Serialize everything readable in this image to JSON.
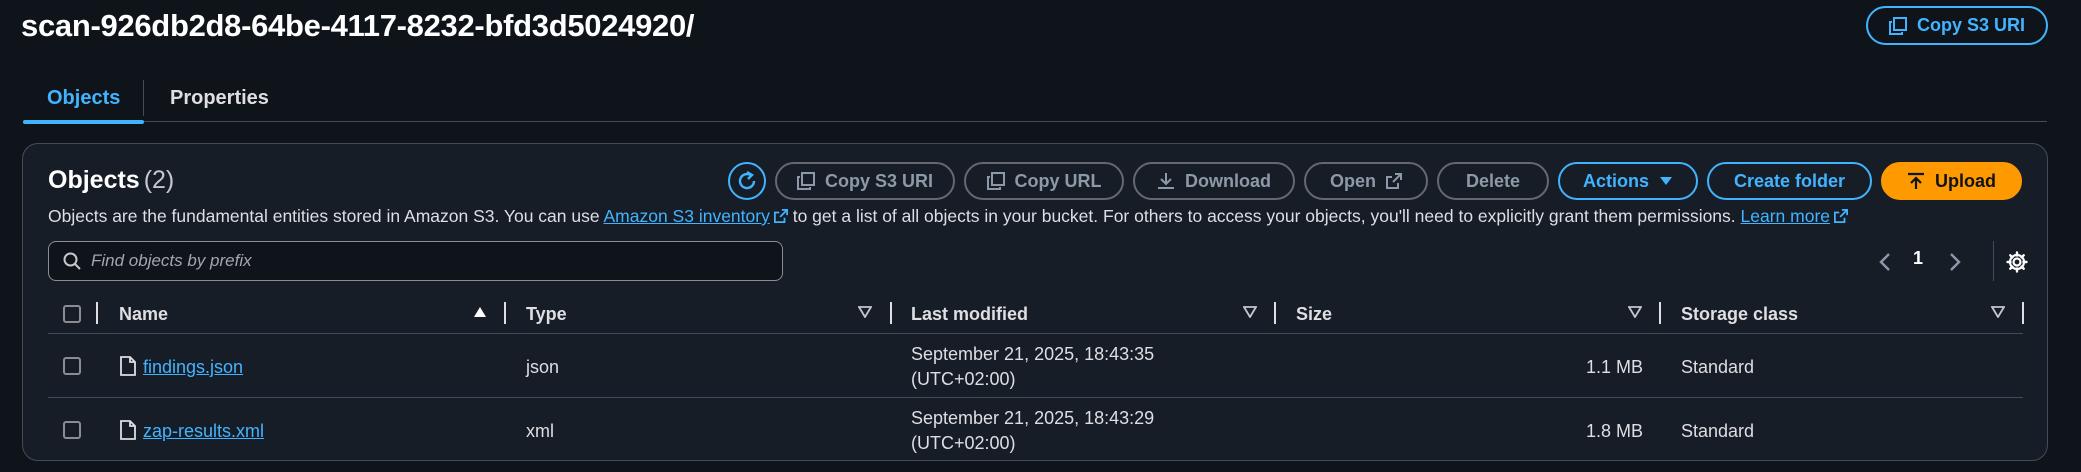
{
  "header": {
    "title": "scan-926db2d8-64be-4117-8232-bfd3d5024920/",
    "copy_s3_uri_label": "Copy S3 URI"
  },
  "tabs": [
    {
      "label": "Objects",
      "active": true
    },
    {
      "label": "Properties",
      "active": false
    }
  ],
  "objects_panel": {
    "title": "Objects",
    "count": "(2)",
    "description_prefix": "Objects are the fundamental entities stored in Amazon S3. You can use ",
    "inventory_link": "Amazon S3 inventory",
    "description_middle": " to get a list of all objects in your bucket. For others to access your objects, you'll need to explicitly grant them permissions. ",
    "learn_more": "Learn more",
    "toolbar": {
      "copy_s3_uri": "Copy S3 URI",
      "copy_url": "Copy URL",
      "download": "Download",
      "open": "Open",
      "delete": "Delete",
      "actions": "Actions",
      "create_folder": "Create folder",
      "upload": "Upload"
    },
    "search": {
      "placeholder": "Find objects by prefix",
      "value": ""
    },
    "pagination": {
      "page": "1"
    },
    "columns": [
      "Name",
      "Type",
      "Last modified",
      "Size",
      "Storage class"
    ],
    "rows": [
      {
        "name": "findings.json",
        "type": "json",
        "modified_line1": "September 21, 2025, 18:43:35",
        "modified_line2": "(UTC+02:00)",
        "size": "1.1 MB",
        "storage_class": "Standard"
      },
      {
        "name": "zap-results.xml",
        "type": "xml",
        "modified_line1": "September 21, 2025, 18:43:29",
        "modified_line2": "(UTC+02:00)",
        "size": "1.8 MB",
        "storage_class": "Standard"
      }
    ]
  },
  "colors": {
    "background": "#0f141a",
    "panel": "#161d26",
    "accent": "#42b4ff",
    "upload": "#ff9900",
    "border": "#414d5c"
  }
}
